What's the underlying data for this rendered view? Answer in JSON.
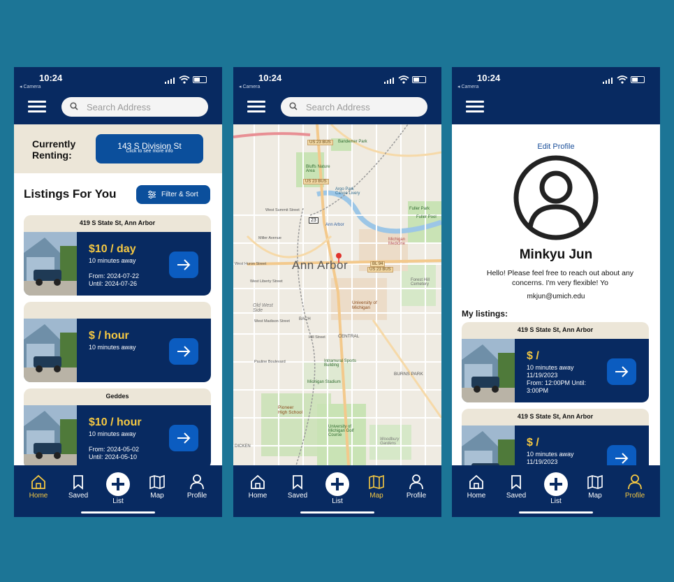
{
  "status": {
    "time": "10:24",
    "back_label": "◂ Camera"
  },
  "search": {
    "placeholder": "Search Address"
  },
  "nav": {
    "home": "Home",
    "saved": "Saved",
    "list": "List",
    "map": "Map",
    "profile": "Profile"
  },
  "home": {
    "renting_label": "Currently Renting:",
    "renting_address": "143 S Division St",
    "renting_sub": "Click to see more info",
    "section_title": "Listings For You",
    "filter_label": "Filter & Sort",
    "listings": [
      {
        "address": "419 S State St, Ann Arbor",
        "price": "$10 / day",
        "distance": "10 minutes away",
        "from": "From: 2024-07-22",
        "until": "Until: 2024-07-26"
      },
      {
        "address": "",
        "price": "$ / hour",
        "distance": "10 minutes away",
        "from": "",
        "until": ""
      },
      {
        "address": "Geddes",
        "price": "$10 / hour",
        "distance": "10 minutes away",
        "from": "From: 2024-05-02",
        "until": "Until: 2024-05-10"
      }
    ]
  },
  "map": {
    "city": "Ann Arbor",
    "labels": {
      "bandemer": "Bandemer Park",
      "bluffs": "Bluffs Nature Area",
      "argo": "Argo Park Canoe Livery",
      "fuller": "Fuller Park",
      "fuller_pool": "Fuller Pool",
      "um_medicine": "Michigan Medicine",
      "forest_hill": "Forest Hill Cemetery",
      "umich": "University of Michigan",
      "old_west": "Old West Side",
      "central": "CENTRAL",
      "burns": "BURNS PARK",
      "stadium": "Michigan Stadium",
      "sports": "Intramural Sports Building",
      "pioneer": "Pioneer High School",
      "golf": "University of Michigan Golf Course",
      "woodbury": "Woodbury Gardens",
      "miller": "Miller Avenue",
      "huron": "West Huron Street",
      "liberty": "West Liberty Street",
      "madison": "West Madison Street",
      "summit": "West Summit Street",
      "pauline": "Pauline Boulevard",
      "dicken": "DICKEN",
      "bach": "BACH",
      "hill": "Hill Street",
      "us23bus_1": "US 23 BUS",
      "us23bus_2": "US 23 BUS",
      "bl94": "BL 94",
      "us23bus_3": "US 23 BUS",
      "shield": "23",
      "amtrak": "Ann Arbor"
    }
  },
  "profile": {
    "edit": "Edit Profile",
    "name": "Minkyu Jun",
    "bio": "Hello! Please feel free to reach out about any concerns. I'm very flexible! Yo",
    "email": "mkjun@umich.edu",
    "my_listings": "My listings:",
    "listings": [
      {
        "address": "419 S State St, Ann Arbor",
        "price": "$ /",
        "distance": "10 minutes away",
        "date": "11/19/2023",
        "time": "From: 12:00PM Until: 3:00PM"
      },
      {
        "address": "419 S State St, Ann Arbor",
        "price": "$ /",
        "distance": "10 minutes away",
        "date": "11/19/2023",
        "time": ""
      }
    ]
  },
  "colors": {
    "navy": "#082a61",
    "accent": "#0b4f9c",
    "gold": "#f5c842",
    "cream": "#ece6d8",
    "background": "#1c7596"
  }
}
